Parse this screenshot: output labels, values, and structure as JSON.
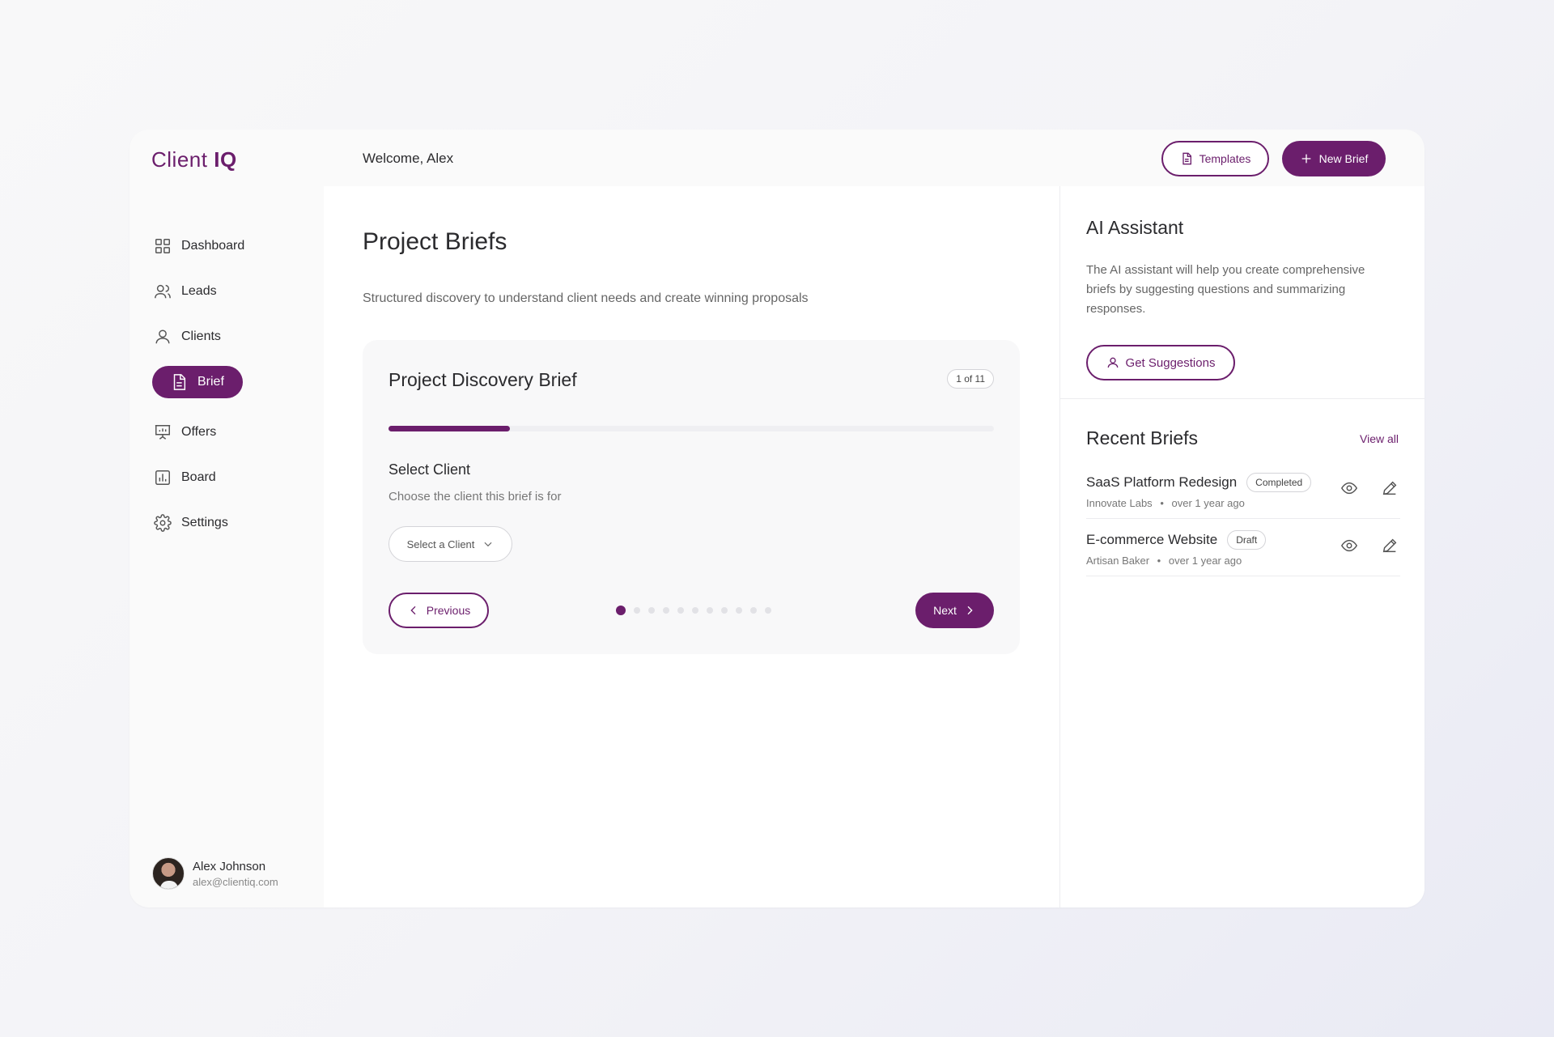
{
  "app": {
    "logo_main": "Client",
    "logo_accent": "IQ",
    "welcome": "Welcome, Alex",
    "accent_color": "#6b1e6c"
  },
  "header": {
    "templates_label": "Templates",
    "new_brief_label": "New Brief"
  },
  "sidebar": {
    "items": [
      {
        "label": "Dashboard",
        "icon": "grid-icon"
      },
      {
        "label": "Leads",
        "icon": "users-icon"
      },
      {
        "label": "Clients",
        "icon": "user-icon"
      },
      {
        "label": "Brief",
        "icon": "document-icon",
        "active": true
      },
      {
        "label": "Offers",
        "icon": "presentation-icon"
      },
      {
        "label": "Board",
        "icon": "bar-chart-icon"
      },
      {
        "label": "Settings",
        "icon": "gear-icon"
      }
    ],
    "user": {
      "name": "Alex Johnson",
      "email": "alex@clientiq.com"
    }
  },
  "main": {
    "title": "Project Briefs",
    "description": "Structured discovery to understand client needs and create winning proposals",
    "card": {
      "title": "Project Discovery Brief",
      "step_badge": "1 of 11",
      "progress_fraction": 0.2,
      "field_label": "Select Client",
      "field_help": "Choose the client this brief is for",
      "select_value": "Select a Client",
      "previous_label": "Previous",
      "next_label": "Next",
      "total_steps": 11,
      "current_step": 1
    }
  },
  "assistant": {
    "title": "AI Assistant",
    "description": "The AI assistant will help you create comprehensive briefs by suggesting questions and summarizing responses.",
    "button_label": "Get Suggestions"
  },
  "recent": {
    "title": "Recent Briefs",
    "view_all": "View all",
    "items": [
      {
        "name": "SaaS Platform Redesign",
        "status": "Completed",
        "client": "Innovate Labs",
        "time": "over 1 year ago"
      },
      {
        "name": "E-commerce Website",
        "status": "Draft",
        "client": "Artisan Baker",
        "time": "over 1 year ago"
      }
    ],
    "separator": "•"
  }
}
